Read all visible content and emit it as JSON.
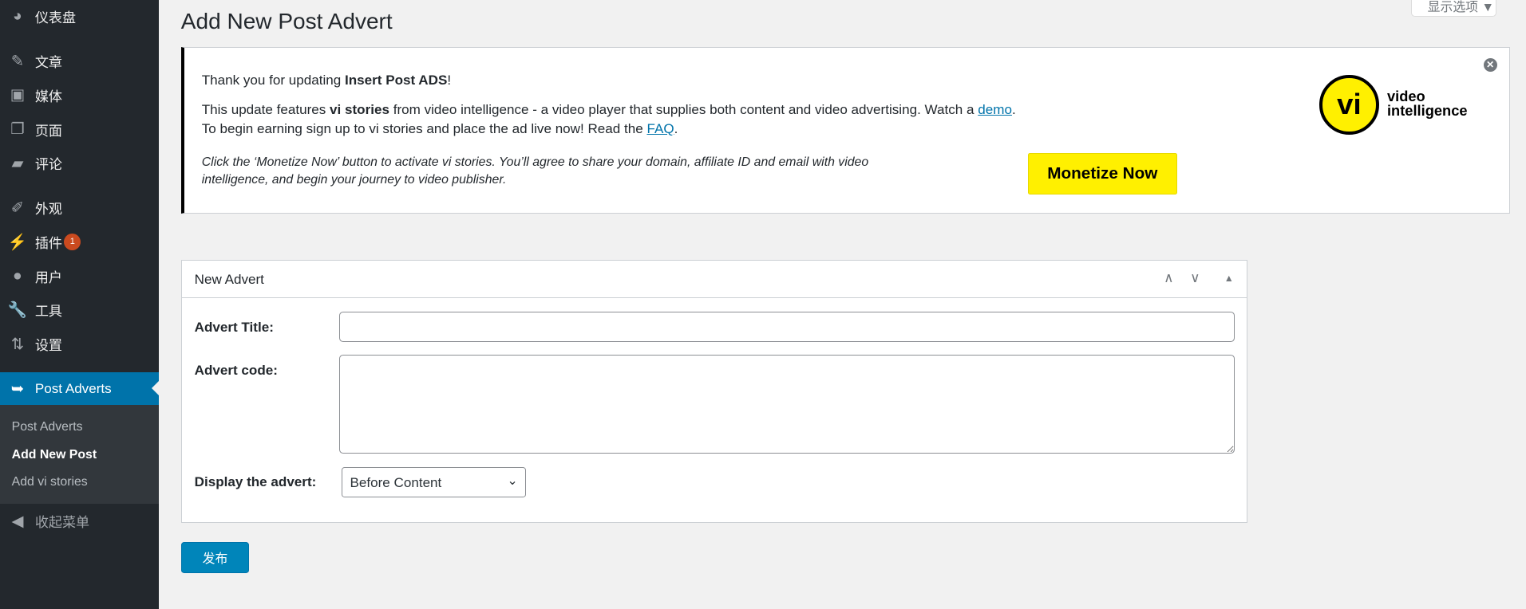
{
  "sidebar": {
    "items": [
      {
        "label": "仪表盘",
        "icon": "dashboard-icon",
        "glyph": "◕"
      },
      {
        "label": "文章",
        "icon": "pin-icon",
        "glyph": "✎"
      },
      {
        "label": "媒体",
        "icon": "media-icon",
        "glyph": "▣"
      },
      {
        "label": "页面",
        "icon": "pages-icon",
        "glyph": "❐"
      },
      {
        "label": "评论",
        "icon": "comment-icon",
        "glyph": "▰"
      },
      {
        "label": "外观",
        "icon": "brush-icon",
        "glyph": "✐"
      },
      {
        "label": "插件",
        "icon": "plugin-icon",
        "glyph": "⚡",
        "badge": "1"
      },
      {
        "label": "用户",
        "icon": "user-icon",
        "glyph": "●"
      },
      {
        "label": "工具",
        "icon": "wrench-icon",
        "glyph": "🔧"
      },
      {
        "label": "设置",
        "icon": "settings-icon",
        "glyph": "⇅"
      },
      {
        "label": "Post Adverts",
        "icon": "exit-arrow-icon",
        "glyph": "➥"
      }
    ],
    "submenu": [
      "Post Adverts",
      "Add New Post",
      "Add vi stories"
    ],
    "collapse": "收起菜单"
  },
  "page": {
    "title": "Add New Post Advert",
    "screen_options": "显示选项 ▼"
  },
  "notice": {
    "l1a": "Thank you for updating ",
    "l1b": "Insert Post ADS",
    "l1c": "!",
    "l2a": "This update features ",
    "l2b": "vi stories",
    "l2c": " from video intelligence - a video player that supplies both content and video advertising. Watch a ",
    "l2link": "demo",
    "l2d": ".",
    "l3a": "To begin earning sign up to vi stories and place the ad live now! Read the ",
    "l3link": "FAQ",
    "l3b": ".",
    "i1": "Click the ‘Monetize Now’ button to activate vi stories. You’ll agree to share your domain, affiliate ID and email with video",
    "i2": "intelligence, and begin your journey to video publisher.",
    "button": "Monetize Now",
    "logo": {
      "mark": "vi",
      "line1": "video",
      "line2": "intelligence"
    },
    "accent": "#fff000"
  },
  "box": {
    "title": "New Advert",
    "title_label": "Advert Title:",
    "title_value": "",
    "code_label": "Advert code:",
    "code_value": "",
    "display_label": "Display the advert:",
    "display_value": "Before Content"
  },
  "publish": "发布"
}
